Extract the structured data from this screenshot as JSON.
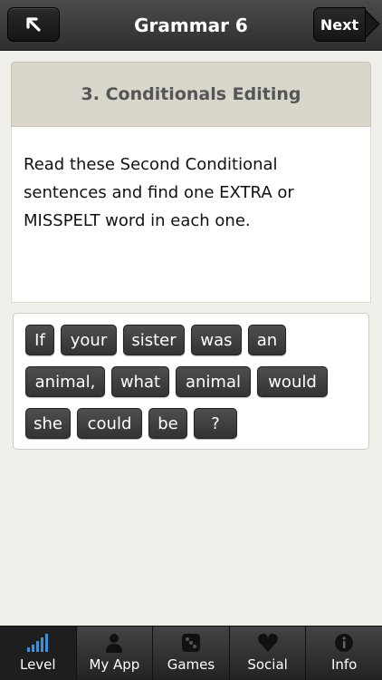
{
  "header": {
    "title": "Grammar 6",
    "next_label": "Next",
    "back_icon": "back-arrow-icon"
  },
  "lesson": {
    "title": "3. Conditionals Editing",
    "instructions": "Read these Second Conditional sentences and find one EXTRA or MISSPELT word in each one."
  },
  "words": [
    "If",
    "your",
    "sister",
    "was",
    "an",
    "animal,",
    "what",
    "animal",
    "would",
    "she",
    "could",
    "be",
    "?"
  ],
  "tabs": [
    {
      "label": "Level",
      "icon": "level-bars-icon",
      "active": true
    },
    {
      "label": "My App",
      "icon": "person-icon",
      "active": false
    },
    {
      "label": "Games",
      "icon": "dice-icon",
      "active": false
    },
    {
      "label": "Social",
      "icon": "heart-icon",
      "active": false
    },
    {
      "label": "Info",
      "icon": "info-icon",
      "active": false
    }
  ],
  "colors": {
    "accent_tab_icon": "#3d8fd6",
    "chip_background": "#3f3f3f",
    "page_background": "#f0efea"
  }
}
